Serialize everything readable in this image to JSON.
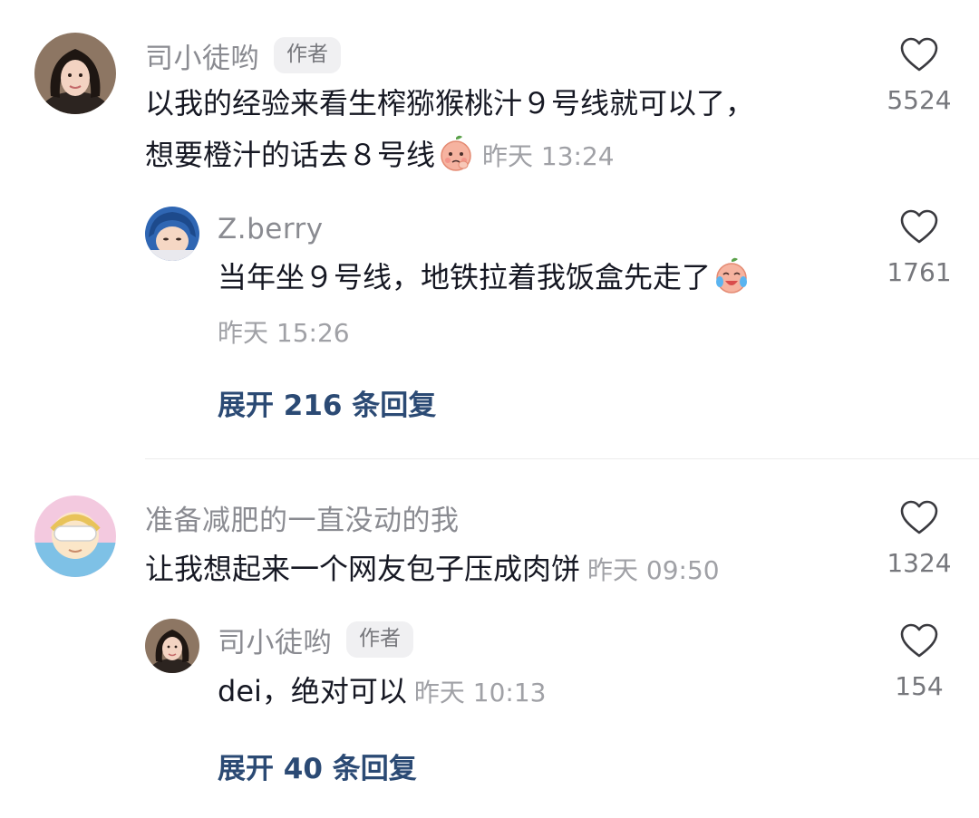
{
  "comments": [
    {
      "username": "司小徒哟",
      "badge": "作者",
      "text_line1": "以我的经验来看生榨猕猴桃汁９号线就可以了，",
      "text_line2": "想要橙汁的话去８号线",
      "time": "昨天 13:24",
      "likes": "5524",
      "emoji": "peach-thinking-emoji",
      "reply": {
        "username": "Z.berry",
        "text": "当年坐９号线，地铁拉着我饭盒先走了",
        "emoji": "peach-crying-laughing-emoji",
        "time": "昨天 15:26",
        "likes": "1761"
      },
      "expand_label": "展开 216 条回复"
    },
    {
      "username": "准备减肥的一直没动的我",
      "text": "让我想起来一个网友包子压成肉饼",
      "time": "昨天 09:50",
      "likes": "1324",
      "reply": {
        "username": "司小徒哟",
        "badge": "作者",
        "text": "dei，绝对可以",
        "time": "昨天 10:13",
        "likes": "154"
      },
      "expand_label": "展开 40 条回复"
    }
  ],
  "colors": {
    "text": "#161823",
    "username": "#8a8b91",
    "time": "#a0a1a6",
    "expand": "#2b4a74",
    "heart_outline": "#3a3a3f"
  },
  "icons": {
    "like": "heart-outline-icon"
  }
}
